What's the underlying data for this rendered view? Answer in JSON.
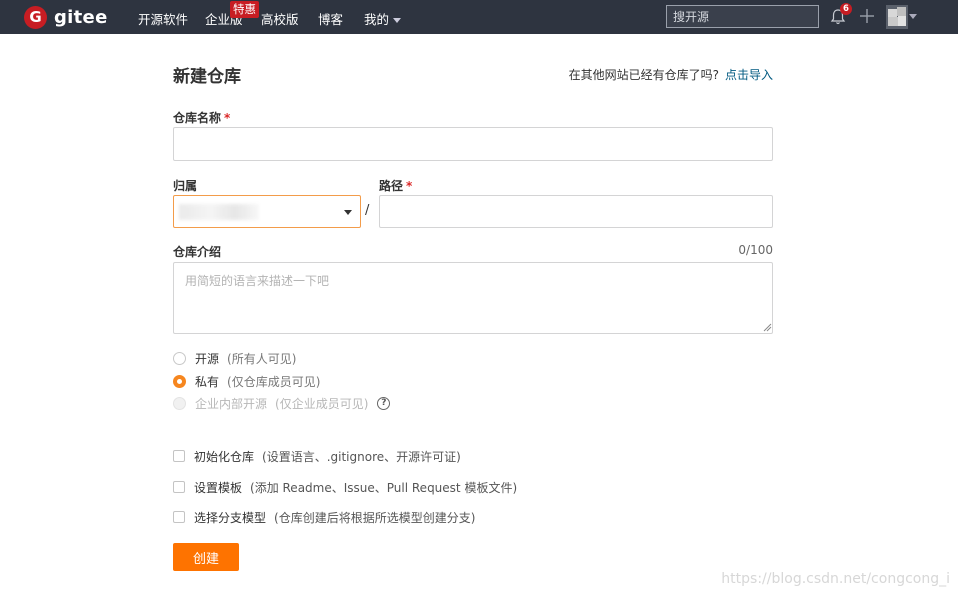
{
  "nav": {
    "logo_letter": "G",
    "logo_text": "gitee",
    "items": [
      {
        "label": "开源软件"
      },
      {
        "label": "企业版"
      },
      {
        "label": "高校版"
      },
      {
        "label": "博客"
      },
      {
        "label": "我的"
      }
    ],
    "hot_badge": "特惠",
    "search_placeholder": "搜开源",
    "notification_count": "6",
    "icons": {
      "bell": "bell-icon",
      "plus": "plus-icon",
      "avatar": "avatar",
      "caret": "chevron-down-icon"
    }
  },
  "form": {
    "title": "新建仓库",
    "import_prompt": "在其他网站已经有仓库了吗?",
    "import_link": "点击导入",
    "name_label": "仓库名称",
    "required_mark": "*",
    "owner_label": "归属",
    "path_label": "路径",
    "separator": "/",
    "description_label": "仓库介绍",
    "description_counter": "0/100",
    "description_placeholder": "用简短的语言来描述一下吧",
    "visibility": [
      {
        "label": "开源",
        "note": "(所有人可见)",
        "checked": false,
        "disabled": false
      },
      {
        "label": "私有",
        "note": "(仅仓库成员可见)",
        "checked": true,
        "disabled": false
      },
      {
        "label": "企业内部开源",
        "note": "(仅企业成员可见)",
        "checked": false,
        "disabled": true
      }
    ],
    "help_glyph": "?",
    "options": [
      {
        "label": "初始化仓库",
        "note": "(设置语言、.gitignore、开源许可证)",
        "checked": false
      },
      {
        "label": "设置模板",
        "note": "(添加 Readme、Issue、Pull Request 模板文件)",
        "checked": false
      },
      {
        "label": "选择分支模型",
        "note": "(仓库创建后将根据所选模型创建分支)",
        "checked": false
      }
    ],
    "submit_label": "创建"
  },
  "colors": {
    "nav_bg": "#2e3440",
    "brand_red": "#c71d23",
    "accent_orange": "#fe7300",
    "link": "#005980"
  },
  "watermark": "https://blog.csdn.net/congcong_i"
}
